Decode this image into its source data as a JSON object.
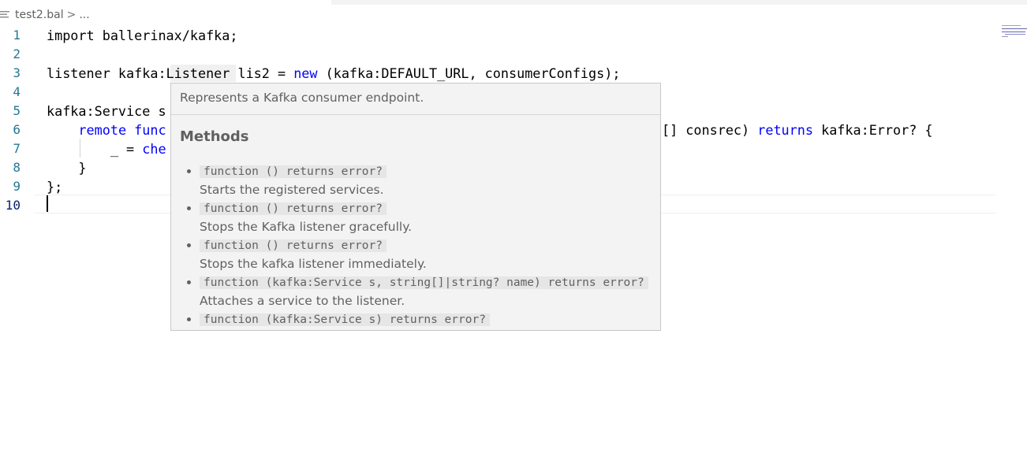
{
  "breadcrumb": {
    "file": "test2.bal",
    "separator": ">",
    "more": "..."
  },
  "editor": {
    "line_numbers": [
      "1",
      "2",
      "3",
      "4",
      "5",
      "6",
      "7",
      "8",
      "9",
      "10"
    ],
    "lines": [
      {
        "parts": [
          {
            "t": "import ballerinax/kafka;",
            "k": false
          }
        ]
      },
      {
        "parts": []
      },
      {
        "parts": [
          {
            "t": "listener kafka:Listener lis2 = ",
            "k": false
          },
          {
            "t": "new",
            "k": true
          },
          {
            "t": " (kafka:DEFAULT_URL, consumerConfigs);",
            "k": false
          }
        ]
      },
      {
        "parts": []
      },
      {
        "parts": [
          {
            "t": "kafka:Service s",
            "k": false
          }
        ]
      },
      {
        "parts": [
          {
            "t": "    ",
            "k": false
          },
          {
            "t": "remote func",
            "k": true
          }
        ]
      },
      {
        "parts": [
          {
            "t": "        _ = ",
            "k": false
          },
          {
            "t": "che",
            "k": true
          }
        ]
      },
      {
        "parts": [
          {
            "t": "    }",
            "k": false
          }
        ]
      },
      {
        "parts": [
          {
            "t": "};",
            "k": false
          }
        ]
      },
      {
        "parts": []
      }
    ],
    "line6_tail": [
      {
        "t": "[] consrec) ",
        "k": false
      },
      {
        "t": "returns",
        "k": true
      },
      {
        "t": " kafka:Error? {",
        "k": false
      }
    ]
  },
  "hover": {
    "summary": "Represents a Kafka consumer endpoint.",
    "methods_title": "Methods",
    "methods": [
      {
        "sig": "function () returns error?",
        "desc": "Starts the registered services."
      },
      {
        "sig": "function () returns error?",
        "desc": "Stops the Kafka listener gracefully."
      },
      {
        "sig": "function () returns error?",
        "desc": "Stops the kafka listener immediately."
      },
      {
        "sig": "function (kafka:Service s, string[]|string? name) returns error?",
        "desc": "Attaches a service to the listener."
      },
      {
        "sig": "function (kafka:Service s) returns error?",
        "desc": ""
      }
    ]
  },
  "colors": {
    "keyword": "#0000ff",
    "line_number": "#237893",
    "hover_bg": "#f3f3f3"
  }
}
